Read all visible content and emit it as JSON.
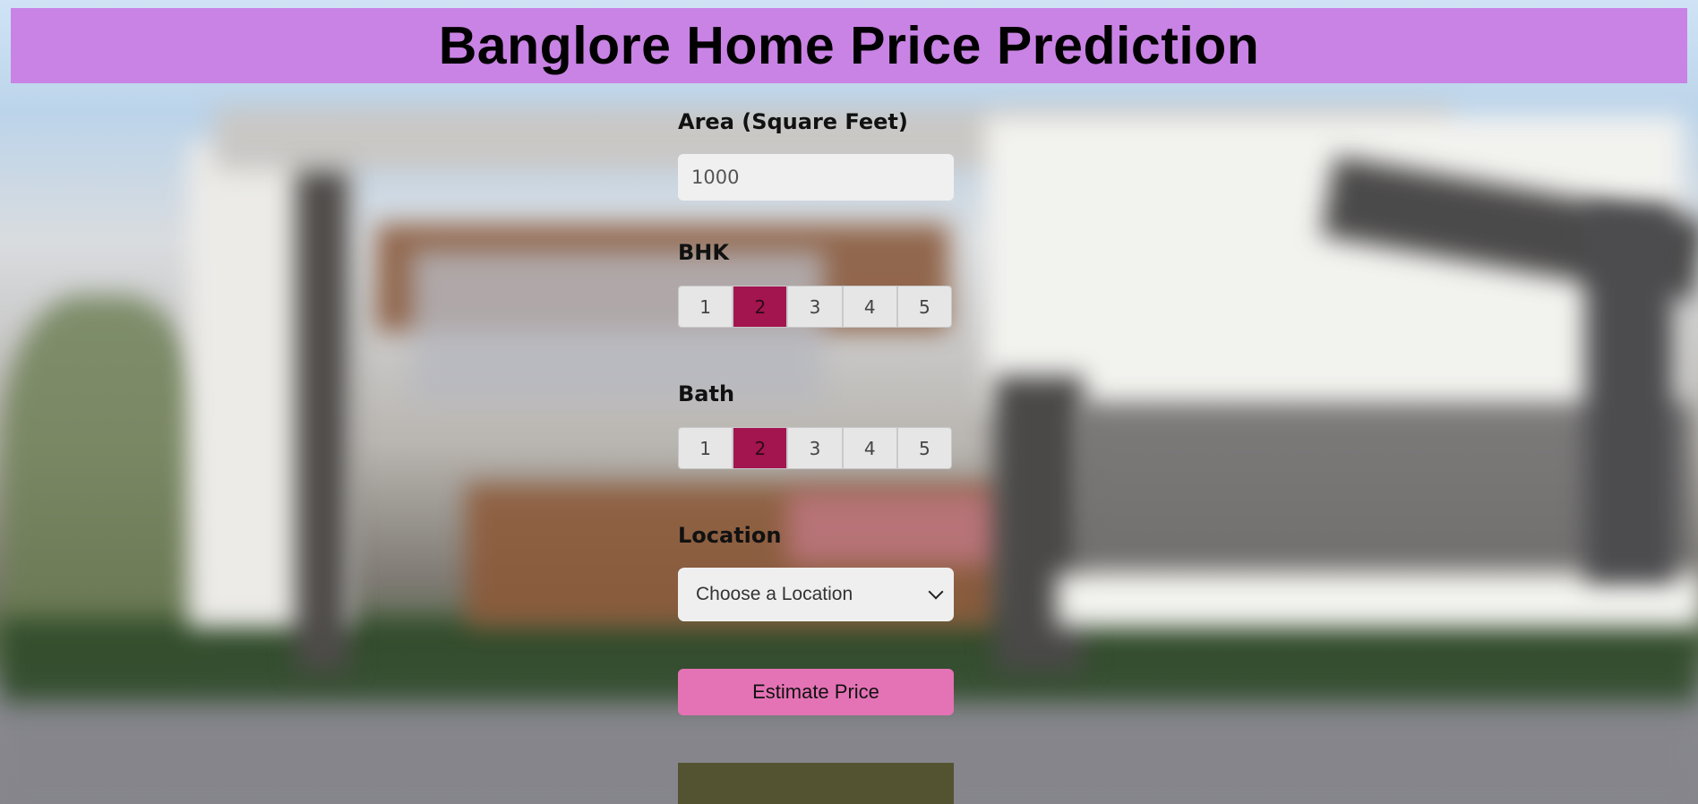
{
  "header": {
    "title": "Banglore Home Price Prediction",
    "background_color": "#c983e4"
  },
  "form": {
    "area": {
      "label": "Area (Square Feet)",
      "value": "1000"
    },
    "bhk": {
      "label": "BHK",
      "options": [
        "1",
        "2",
        "3",
        "4",
        "5"
      ],
      "selected": "2"
    },
    "bath": {
      "label": "Bath",
      "options": [
        "1",
        "2",
        "3",
        "4",
        "5"
      ],
      "selected": "2"
    },
    "location": {
      "label": "Location",
      "selected_text": "Choose a Location",
      "icon": "chevron-down-icon"
    },
    "estimate_button": {
      "label": "Estimate Price",
      "color": "#e473b5"
    },
    "result": {
      "text": "",
      "color": "#545331"
    }
  },
  "colors": {
    "selected_option": "#a3154f"
  }
}
